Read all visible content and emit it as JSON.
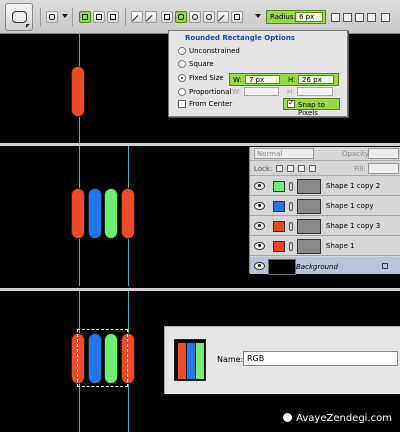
{
  "options_bar": {
    "radius_label": "Radius:",
    "radius_value": "6 px"
  },
  "rounded_rect_options": {
    "title": "Rounded Rectangle Options",
    "options": [
      "Unconstrained",
      "Square",
      "Fixed Size",
      "Proportional"
    ],
    "selected": "Fixed Size",
    "w_label": "W:",
    "w_value": "7 px",
    "h_label": "H:",
    "h_value": "26 px",
    "from_center_label": "From Center",
    "snap_label": "Snap to Pixels",
    "snap_checked": true
  },
  "layers_panel": {
    "blend_mode": "Normal",
    "opacity_label": "Opacity:",
    "lock_label": "Lock:",
    "fill_label": "Fill:",
    "layers": [
      {
        "name": "Shape 1 copy 2",
        "color": "#6ef06e"
      },
      {
        "name": "Shape 1 copy",
        "color": "#2277ee"
      },
      {
        "name": "Shape 1 copy 3",
        "color": "#ee4422"
      },
      {
        "name": "Shape 1",
        "color": "#ee4422"
      }
    ],
    "background_label": "Background"
  },
  "swatch_dialog": {
    "name_label": "Name:",
    "name_value": "RGB"
  },
  "colors": {
    "red": "#f04a28",
    "blue": "#2277ee",
    "green": "#6ef06e",
    "guide": "#3ab7c7"
  },
  "watermark": "AvayeZendegi.com"
}
